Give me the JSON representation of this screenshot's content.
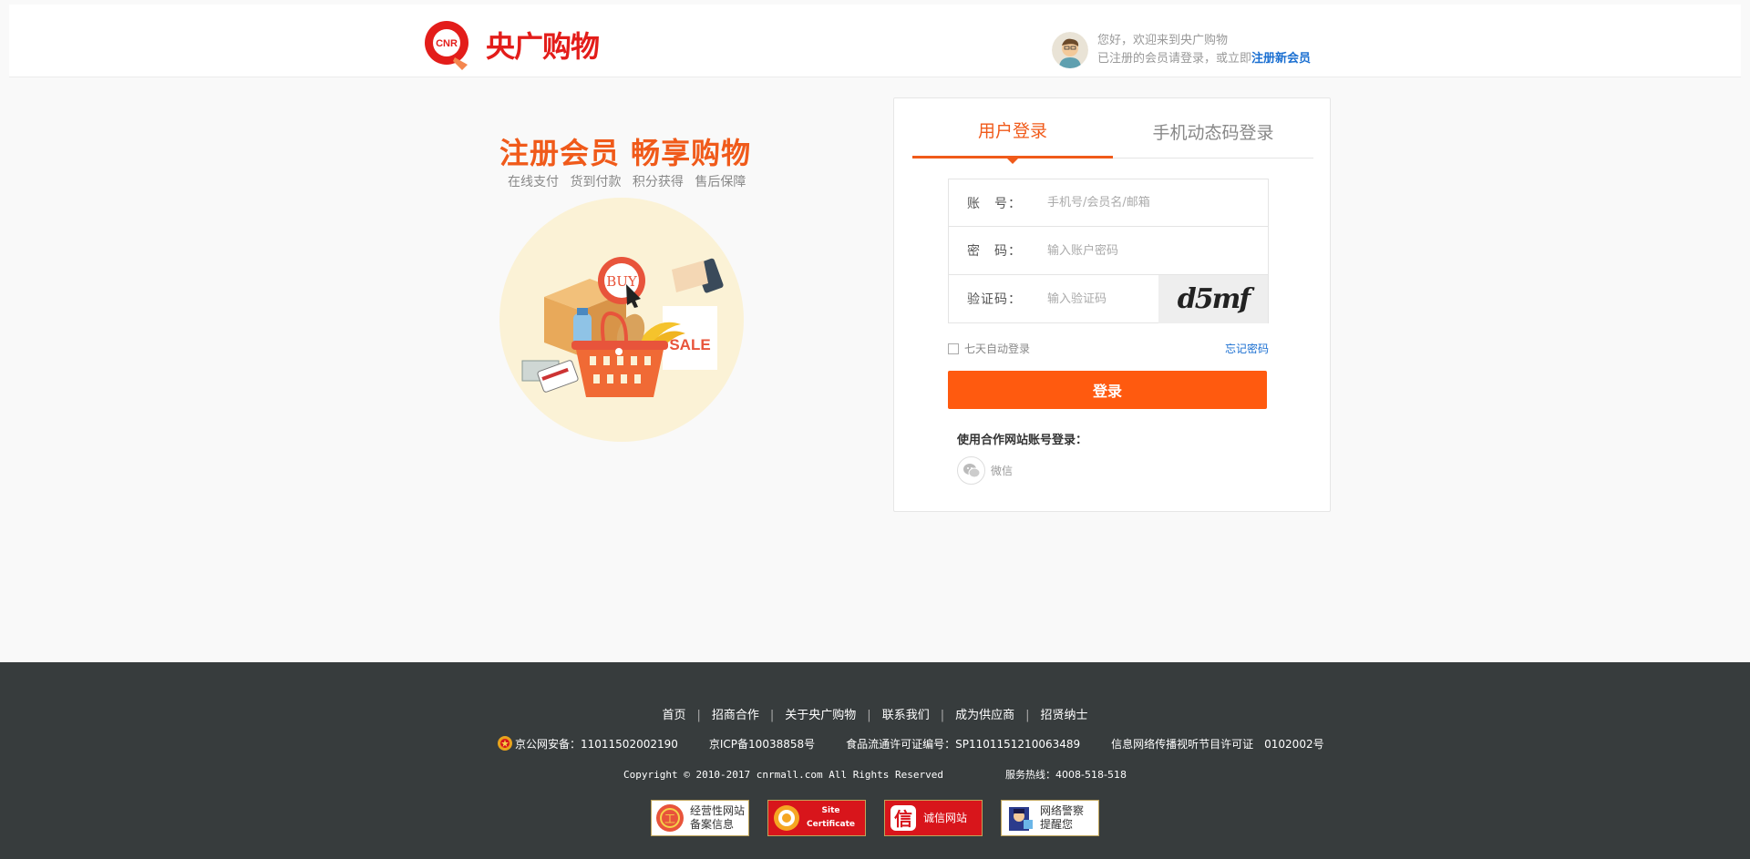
{
  "brand": {
    "name": "央广购物",
    "logo_badge": "CNR",
    "color": "#e31d1a"
  },
  "header": {
    "greeting": "您好，欢迎来到央广购物",
    "prompt": "已注册的会员请登录，或立即",
    "register_link": "注册新会员"
  },
  "promo": {
    "title": "注册会员 畅享购物",
    "subtitle": "在线支付  货到付款  积分获得  售后保障",
    "image_text_buy": "BUY",
    "image_text_sale": "SALE"
  },
  "login": {
    "tabs": [
      {
        "label": "用户登录",
        "active": true
      },
      {
        "label": "手机动态码登录",
        "active": false
      }
    ],
    "account_label": "账　号：",
    "account_placeholder": "手机号/会员名/邮箱",
    "password_label": "密　码：",
    "password_placeholder": "输入账户密码",
    "captcha_label": "验证码：",
    "captcha_placeholder": "输入验证码",
    "captcha_text": "d5mf",
    "remember_label": "七天自动登录",
    "forgot_label": "忘记密码",
    "submit_label": "登录",
    "partner_label": "使用合作网站账号登录：",
    "wechat_label": "微信",
    "accent_color": "#ff5a0f",
    "link_color": "#1a6fd1"
  },
  "footer": {
    "links": [
      "首页",
      "招商合作",
      "关于央广购物",
      "联系我们",
      "成为供应商",
      "招贤纳士"
    ],
    "police": "京公网安备：11011502002190",
    "icp": "京ICP备10038858号",
    "food_license": "食品流通许可证编号：SP1101151210063489",
    "av_license": "信息网络传播视听节目许可证　0102002号",
    "copyright": "Copyright © 2010-2017  cnrmall.com  All  Rights  Reserved",
    "hotline": "服务热线：4008-518-518",
    "certs": [
      {
        "line1": "经营性网站",
        "line2": "备案信息"
      },
      {
        "line1": "Site",
        "line2": "Certificate"
      },
      {
        "line1": "诚信网站",
        "line2": ""
      },
      {
        "line1": "网络警察",
        "line2": "提醒您"
      }
    ],
    "background": "#373c3d"
  }
}
